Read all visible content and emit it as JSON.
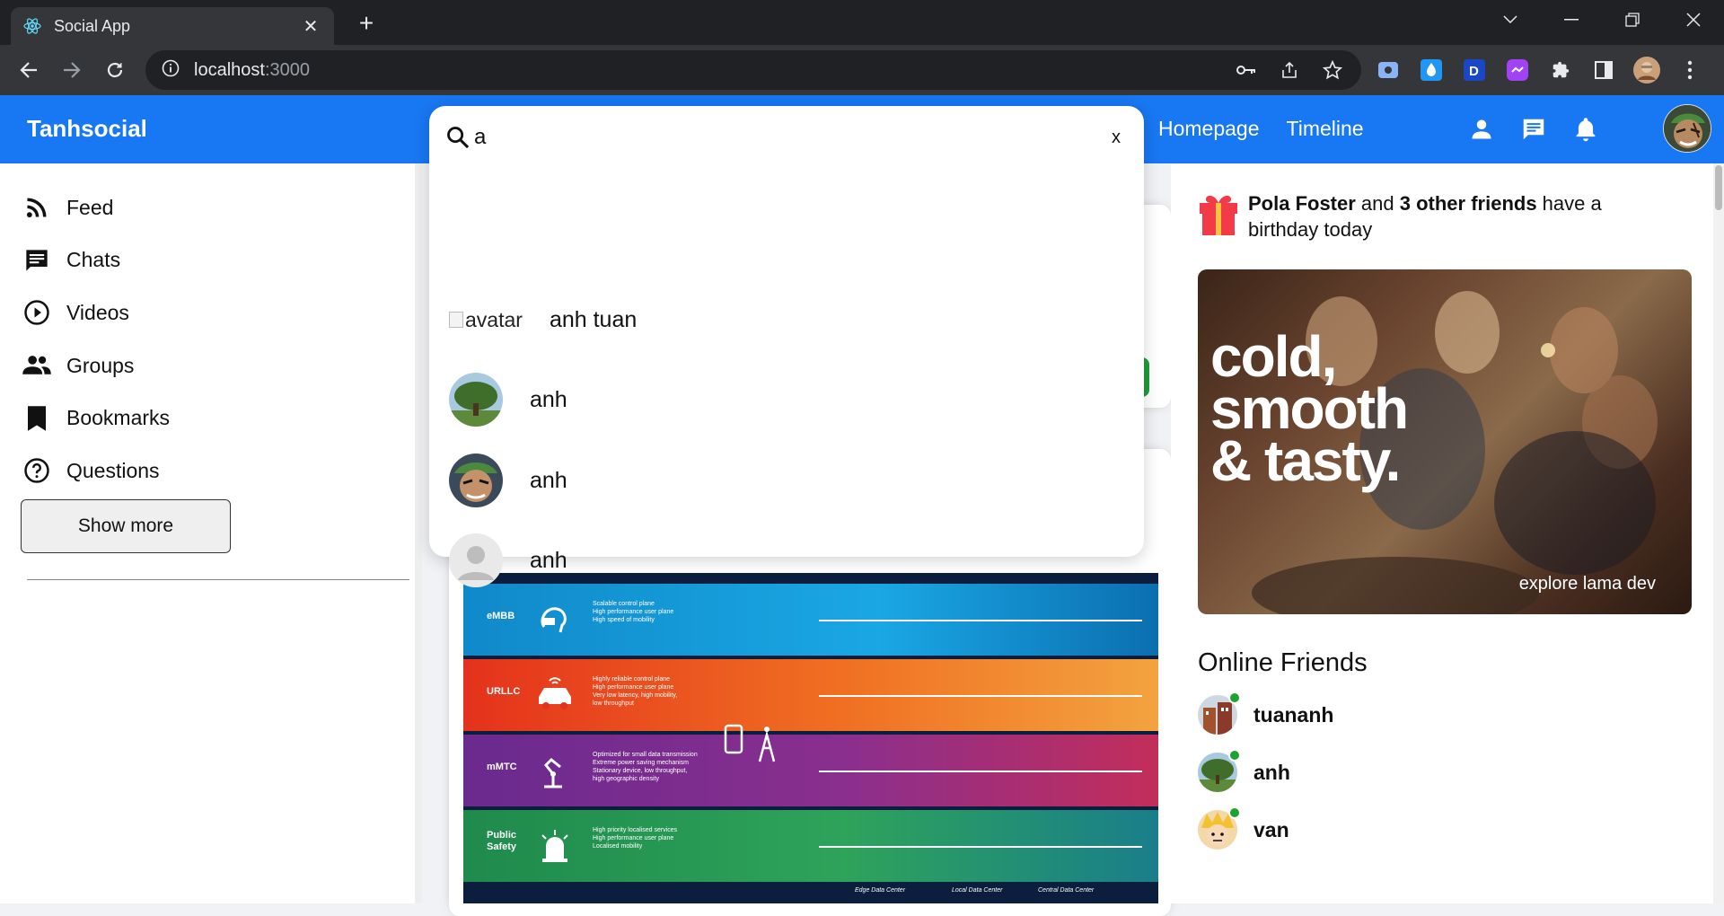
{
  "browser": {
    "tab_title": "Social App",
    "url_host": "localhost",
    "url_port": ":3000"
  },
  "app": {
    "logo": "Tanhsocial",
    "nav_links": [
      "Homepage",
      "Timeline"
    ]
  },
  "sidebar": {
    "items": [
      {
        "label": "Feed",
        "icon": "rss-feed-icon"
      },
      {
        "label": "Chats",
        "icon": "chat-icon"
      },
      {
        "label": "Videos",
        "icon": "play-circle-icon"
      },
      {
        "label": "Groups",
        "icon": "group-icon"
      },
      {
        "label": "Bookmarks",
        "icon": "bookmark-icon"
      },
      {
        "label": "Questions",
        "icon": "help-circle-icon"
      }
    ],
    "show_more": "Show more"
  },
  "search": {
    "value": "a",
    "clear_label": "x",
    "results": [
      {
        "name": "anh tuan",
        "avatar_alt": "avatar",
        "avatar_broken": true
      },
      {
        "name": "anh",
        "avatar": "tree"
      },
      {
        "name": "anh",
        "avatar": "anime-face"
      },
      {
        "name": "anh",
        "avatar": "default-user"
      }
    ]
  },
  "post_image": {
    "bands": [
      {
        "label": "eMBB",
        "lines": [
          "Scalable control plane",
          "High performance user plane",
          "High speed of mobility"
        ],
        "color": "#1597d8"
      },
      {
        "label": "URLLC",
        "lines": [
          "Highly reliable control plane",
          "High performance user plane",
          "Very low latency, high mobility,",
          "low throughput"
        ],
        "color": "#ee5a1c"
      },
      {
        "label": "mMTC",
        "lines": [
          "Optimized for small data transmission",
          "Extreme power saving mechanism",
          "Stationary device, low throughput,",
          "high geographic density"
        ],
        "color": "#7b2d8f"
      },
      {
        "label": "Public Safety",
        "lines": [
          "High priority localised services",
          "High performance user plane",
          "Localised mobility"
        ],
        "color": "#2e9e4f"
      }
    ],
    "footer_labels": [
      "Edge Data Center",
      "Local Data Center",
      "Central Data Center"
    ]
  },
  "rightbar": {
    "birthday": {
      "name": "Pola Foster",
      "connector": " and ",
      "others": "3 other friends",
      "suffix": " have a birthday today"
    },
    "ad": {
      "heading_lines": [
        "cold,",
        "smooth",
        "& tasty."
      ],
      "footer": "explore lama dev"
    },
    "online_title": "Online Friends",
    "friends": [
      {
        "name": "tuananh",
        "avatar": "building"
      },
      {
        "name": "anh",
        "avatar": "tree"
      },
      {
        "name": "van",
        "avatar": "anime-blond"
      }
    ],
    "online_color": "#1ea230"
  },
  "colors": {
    "topbar": "#1877f2",
    "chrome_dark": "#202124",
    "chrome_mid": "#35363a"
  }
}
